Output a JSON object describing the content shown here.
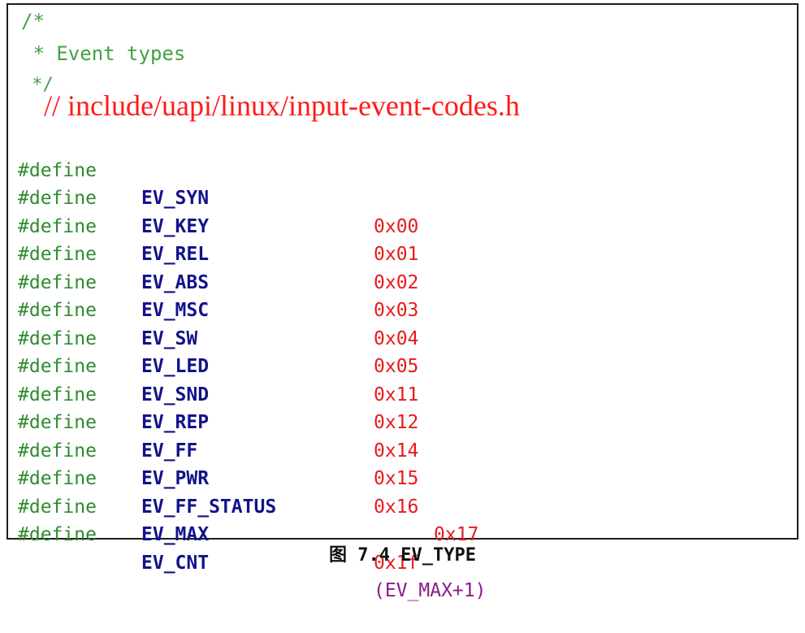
{
  "comment": {
    "open": "/*",
    "text": " * Event types",
    "close": " */"
  },
  "path_note": "// include/uapi/linux/input-event-codes.h",
  "defines": [
    {
      "keyword": "#define",
      "name": "EV_SYN",
      "value": "0x00"
    },
    {
      "keyword": "#define",
      "name": "EV_KEY",
      "value": "0x01"
    },
    {
      "keyword": "#define",
      "name": "EV_REL",
      "value": "0x02"
    },
    {
      "keyword": "#define",
      "name": "EV_ABS",
      "value": "0x03"
    },
    {
      "keyword": "#define",
      "name": "EV_MSC",
      "value": "0x04"
    },
    {
      "keyword": "#define",
      "name": "EV_SW",
      "value": "0x05"
    },
    {
      "keyword": "#define",
      "name": "EV_LED",
      "value": "0x11"
    },
    {
      "keyword": "#define",
      "name": "EV_SND",
      "value": "0x12"
    },
    {
      "keyword": "#define",
      "name": "EV_REP",
      "value": "0x14"
    },
    {
      "keyword": "#define",
      "name": "EV_FF",
      "value": "0x15"
    },
    {
      "keyword": "#define",
      "name": "EV_PWR",
      "value": "0x16"
    },
    {
      "keyword": "#define",
      "name": "EV_FF_STATUS",
      "value": "0x17"
    },
    {
      "keyword": "#define",
      "name": "EV_MAX",
      "value": "0x1f"
    },
    {
      "keyword": "#define",
      "name": "EV_CNT",
      "value": "(EV_MAX+1)"
    }
  ],
  "caption": "图 7.4 EV_TYPE",
  "colors": {
    "comment": "#44a044",
    "keyword": "#2e8b2e",
    "macro_name": "#12128c",
    "value": "#e81a1a",
    "expression": "#8b1a8b",
    "path_note": "#ff1a1a",
    "border": "#1c1c1c"
  }
}
